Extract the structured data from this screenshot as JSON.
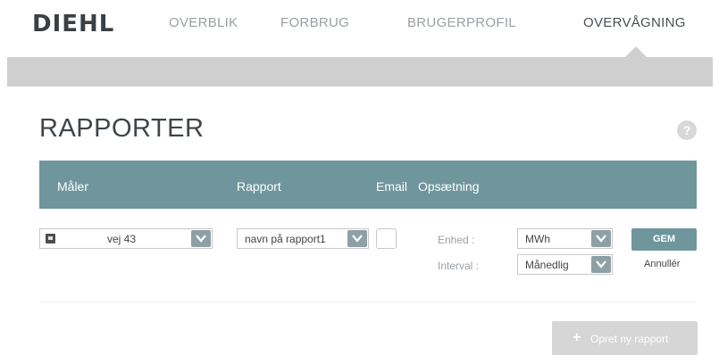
{
  "brand": {
    "logo_text": "DIEHL"
  },
  "nav": {
    "items": [
      {
        "label": "OVERBLIK"
      },
      {
        "label": "FORBRUG"
      },
      {
        "label": "BRUGERPROFIL"
      },
      {
        "label": "OVERVÅGNING",
        "active": true
      }
    ]
  },
  "page": {
    "title": "RAPPORTER",
    "help_label": "?"
  },
  "table": {
    "headers": {
      "maler": "Måler",
      "rapport": "Rapport",
      "email": "Email",
      "opsaetning": "Opsætning"
    },
    "row": {
      "maler_value": "vej 43",
      "rapport_value": "navn på rapport1",
      "email_checked": false,
      "enhed_label": "Enhed :",
      "enhed_value": "MWh",
      "interval_label": "Interval :",
      "interval_value": "Månedlig",
      "save_label": "GEM",
      "cancel_label": "Annullér"
    }
  },
  "actions": {
    "new_report_label": "Opret ny rapport",
    "new_report_icon": "plus-icon"
  },
  "colors": {
    "header_teal": "#6e969c",
    "dropdown_arrow": "#8ea0a5",
    "gray_bar": "#cfcfcf"
  }
}
